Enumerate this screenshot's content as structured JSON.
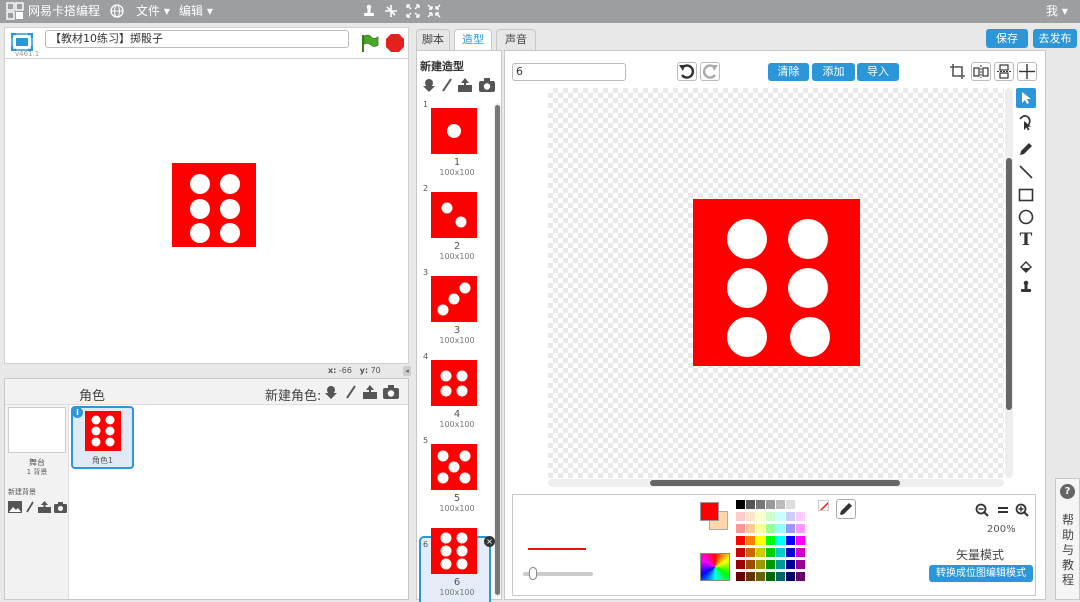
{
  "topbar": {
    "brand": "网易卡搭编程",
    "menu_file": "文件 ▾",
    "menu_edit": "编辑 ▾",
    "user": "我 ▾"
  },
  "project": {
    "title": "【教材10练习】掷骰子",
    "version": "v461.1"
  },
  "stage": {
    "coords_x_label": "x:",
    "coords_x": "-66",
    "coords_y_label": "y:",
    "coords_y": "70"
  },
  "sprite_panel": {
    "header": "角色",
    "new_sprite_label": "新建角色:",
    "stage_label": "舞台",
    "stage_backdrops": "1 背景",
    "new_backdrop_label": "新建背景",
    "sprites": [
      {
        "name": "角色1"
      }
    ]
  },
  "tabs": {
    "scripts": "脚本",
    "costumes": "造型",
    "sounds": "声音"
  },
  "header_buttons": {
    "save": "保存",
    "publish": "去发布"
  },
  "costume_list": {
    "header": "新建造型",
    "items": [
      {
        "index": "1",
        "name": "1",
        "size": "100x100",
        "dots": 1
      },
      {
        "index": "2",
        "name": "2",
        "size": "100x100",
        "dots": 2
      },
      {
        "index": "3",
        "name": "3",
        "size": "100x100",
        "dots": 3
      },
      {
        "index": "4",
        "name": "4",
        "size": "100x100",
        "dots": 4
      },
      {
        "index": "5",
        "name": "5",
        "size": "100x100",
        "dots": 5
      },
      {
        "index": "6",
        "name": "6",
        "size": "100x100",
        "dots": 6,
        "selected": true
      }
    ]
  },
  "editor": {
    "costume_name": "6",
    "clear_label": "清除",
    "add_label": "添加",
    "import_label": "导入",
    "zoom_level": "200%",
    "mode_label": "矢量模式",
    "convert_label": "转换成位图编辑模式"
  },
  "help": {
    "label": "帮助与教程"
  },
  "colors": {
    "accent": "#2b97d8",
    "die_red": "#ff0000",
    "topbar": "#9c9ea2",
    "fill_color": "#ff0000",
    "stroke_color": "#ffd7a8"
  },
  "palette": [
    [
      "#000000",
      "#555555",
      "#777777",
      "#999999",
      "#bbbbbb",
      "#dddddd",
      "#ffffff"
    ],
    [
      "#ffcccc",
      "#ffe5cc",
      "#ffffcc",
      "#ccffcc",
      "#ccffff",
      "#ccccff",
      "#ffccff"
    ],
    [
      "#ff9999",
      "#ffcc99",
      "#ffff99",
      "#99ff99",
      "#99ffff",
      "#9999ff",
      "#ff99ff"
    ],
    [
      "#ff0000",
      "#ff8000",
      "#ffff00",
      "#00ff00",
      "#00ffff",
      "#0000ff",
      "#ff00ff"
    ],
    [
      "#cc0000",
      "#cc6600",
      "#cccc00",
      "#00cc00",
      "#00cccc",
      "#0000cc",
      "#cc00cc"
    ],
    [
      "#990000",
      "#994c00",
      "#999900",
      "#009900",
      "#009999",
      "#000099",
      "#990099"
    ],
    [
      "#660000",
      "#663300",
      "#666600",
      "#006600",
      "#006666",
      "#000066",
      "#660066"
    ]
  ]
}
